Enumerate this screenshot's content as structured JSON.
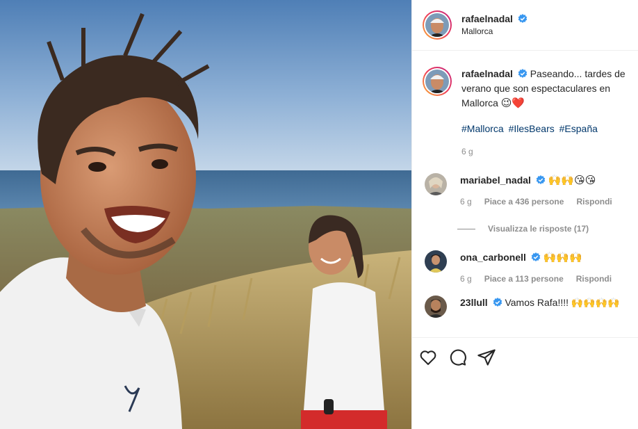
{
  "post": {
    "header": {
      "username": "rafaelnadal",
      "location": "Mallorca"
    },
    "caption": {
      "username": "rafaelnadal",
      "text": "Paseando... tardes de verano que son espectaculares en Mallorca",
      "emojis": "😉❤️",
      "hashtags": [
        "#Mallorca",
        "#IlesBears",
        "#España"
      ],
      "time": "6 g"
    },
    "comments": [
      {
        "username": "mariabel_nadal",
        "text": "🙌🙌😘😘",
        "time": "6 g",
        "likes": "Piace a 436 persone",
        "reply": "Rispondi",
        "view_replies": "Visualizza le risposte (17)"
      },
      {
        "username": "ona_carbonell",
        "text": "🙌🙌🙌",
        "time": "6 g",
        "likes": "Piace a 113 persone",
        "reply": "Rispondi"
      },
      {
        "username": "23llull",
        "text": "Vamos Rafa!!!! 🙌🙌🙌🙌"
      }
    ],
    "actions": {
      "like_icon": "heart-icon",
      "comment_icon": "comment-icon",
      "share_icon": "send-icon"
    },
    "colors": {
      "verified": "#3897f0",
      "hashtag": "#00376b",
      "secondary_text": "#8e8e8e"
    }
  }
}
